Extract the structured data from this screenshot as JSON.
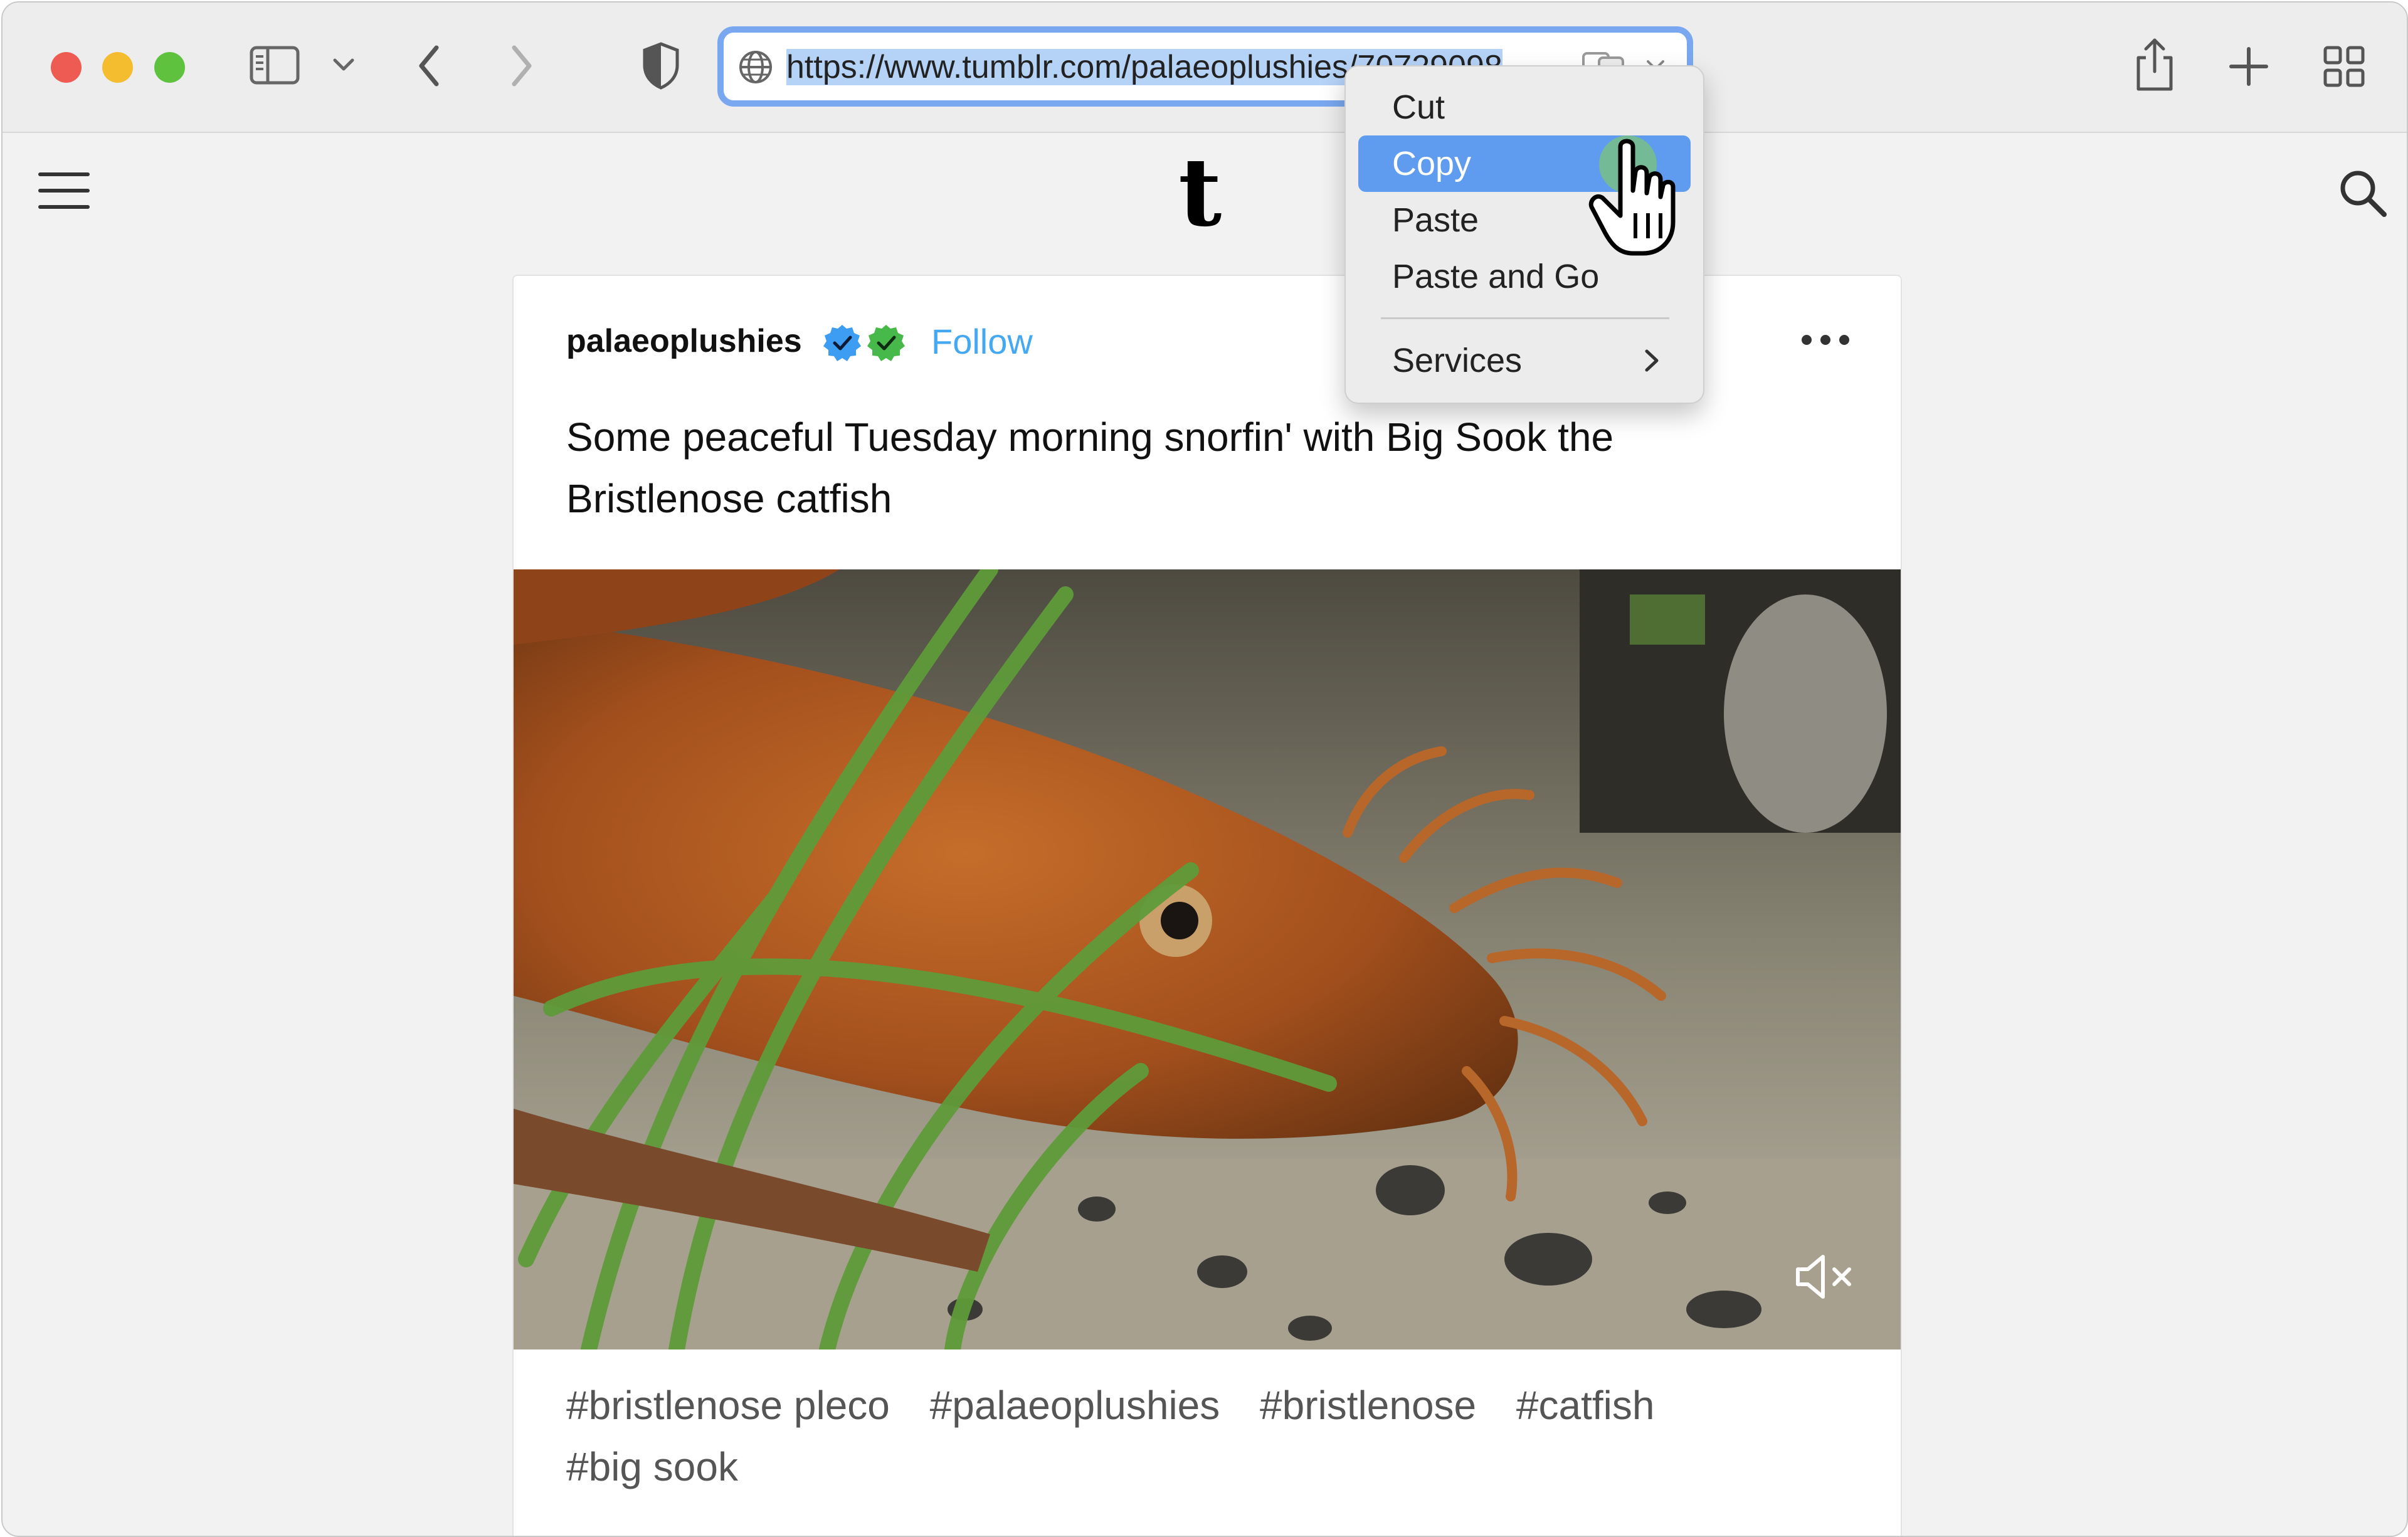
{
  "browser": {
    "url": "https://www.tumblr.com/palaeoplushies/70729098",
    "tab_overview_icon": "grid-icon",
    "share_icon": "share-icon",
    "new_tab_icon": "plus-icon"
  },
  "site": {
    "logo": "t",
    "menu_icon": "hamburger-icon",
    "search_icon": "search-icon"
  },
  "post": {
    "author": "palaeoplushies",
    "follow_label": "Follow",
    "caption": "Some peaceful Tuesday morning snorfin' with Big Sook the Bristlenose catfish",
    "tags": [
      "#bristlenose pleco",
      "#palaeoplushies",
      "#bristlenose",
      "#catfish",
      "#big sook"
    ],
    "media_state": "muted"
  },
  "context_menu": {
    "items": [
      {
        "label": "Cut"
      },
      {
        "label": "Copy"
      },
      {
        "label": "Paste"
      },
      {
        "label": "Paste and Go"
      },
      {
        "label": "Services"
      }
    ],
    "highlighted": "Copy"
  },
  "colors": {
    "accent": "#44a8f2",
    "menu_highlight": "#5f9cf0",
    "url_focus_ring": "#7aa8f0",
    "badge_blue": "#3d9df2",
    "badge_green": "#47b84a"
  }
}
